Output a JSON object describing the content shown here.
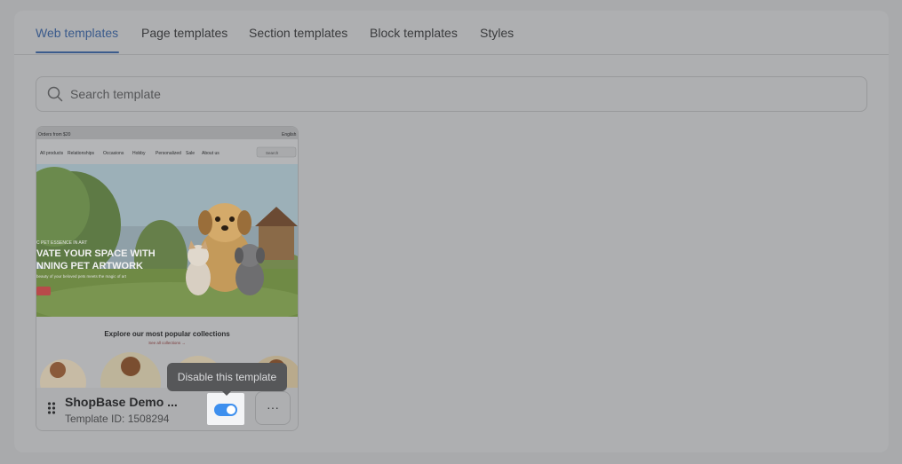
{
  "tabs": [
    {
      "label": "Web templates",
      "active": true
    },
    {
      "label": "Page templates",
      "active": false
    },
    {
      "label": "Section templates",
      "active": false
    },
    {
      "label": "Block templates",
      "active": false
    },
    {
      "label": "Styles",
      "active": false
    }
  ],
  "search": {
    "placeholder": "Search template"
  },
  "template_card": {
    "name": "ShopBase Demo ...",
    "id_text": "Template ID: 1508294",
    "enabled": true,
    "more_label": "···",
    "tooltip": "Disable this template",
    "preview": {
      "announcement": "Orders from $20",
      "language": "English",
      "nav": [
        "All products",
        "Relationships",
        "Occasions",
        "Hobby",
        "Personalized",
        "Sale",
        "About us"
      ],
      "search_placeholder": "Search",
      "hero_kicker": "C PET ESSENCE IN ART",
      "hero_line1": "VATE YOUR SPACE WITH",
      "hero_line2": "NNING PET ARTWORK",
      "hero_sub": "beauty of your beloved pets meets the magic of art",
      "collections_title": "Explore our most popular collections",
      "collections_link": "See all collections →"
    }
  },
  "colors": {
    "accent": "#3b5b8c",
    "toggle_on": "#3d8fee"
  }
}
